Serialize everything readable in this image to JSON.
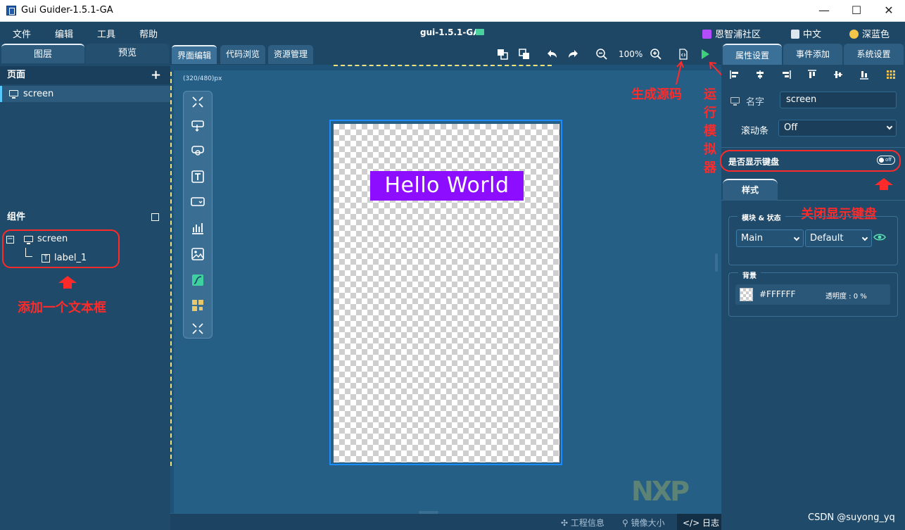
{
  "window": {
    "title": "Gui Guider-1.5.1-GA",
    "minimize_glyph": "—",
    "maximize_glyph": "☐",
    "close_glyph": "✕"
  },
  "menubar": {
    "items": [
      "文件",
      "编辑",
      "工具",
      "帮助"
    ],
    "project_name": "gui-1.5.1-GA",
    "community": "恩智浦社区",
    "language": "中文",
    "theme": "深蓝色"
  },
  "left": {
    "tabs": [
      "图层",
      "预览"
    ],
    "pages_header": "页面",
    "add_glyph": "+",
    "page_item": "screen",
    "components_header": "组件",
    "tree_root": "screen",
    "tree_child": "label_1",
    "collapse_glyph": "−",
    "annotation": "添加一个文本框"
  },
  "center": {
    "tabs": [
      "界面编辑",
      "代码浏览",
      "资源管理"
    ],
    "zoom": "100%",
    "resolution": "(320/480)px",
    "label_text": "Hello World",
    "annotation_generate": "生成源码",
    "annotation_simulator": "运行模拟器",
    "watermark": "NXP",
    "status": {
      "project_info": "工程信息",
      "mirror_size": "镜像大小",
      "log": "日志"
    }
  },
  "right": {
    "tabs": [
      "属性设置",
      "事件添加",
      "系统设置"
    ],
    "name_label": "名字",
    "name_value": "screen",
    "scrollbar_label": "滚动条",
    "scrollbar_value": "Off",
    "keyboard_label": "是否显示键盘",
    "keyboard_toggle": "off",
    "style_tab": "样式",
    "annotation_keyboard": "关闭显示键盘",
    "module_state_label": "模块 & 状态",
    "module_value": "Main",
    "state_value": "Default",
    "background_label": "背景",
    "bg_color": "#FFFFFF",
    "opacity_label": "透明度 : 0 %"
  },
  "footer_watermark": "CSDN @suyong_yq",
  "colors": {
    "accent": "#1a8cff",
    "annotation": "#ff2a2a",
    "label_bg": "#8c0dff",
    "panel_bg": "#1f4a69",
    "canvas_area": "#255f86"
  }
}
